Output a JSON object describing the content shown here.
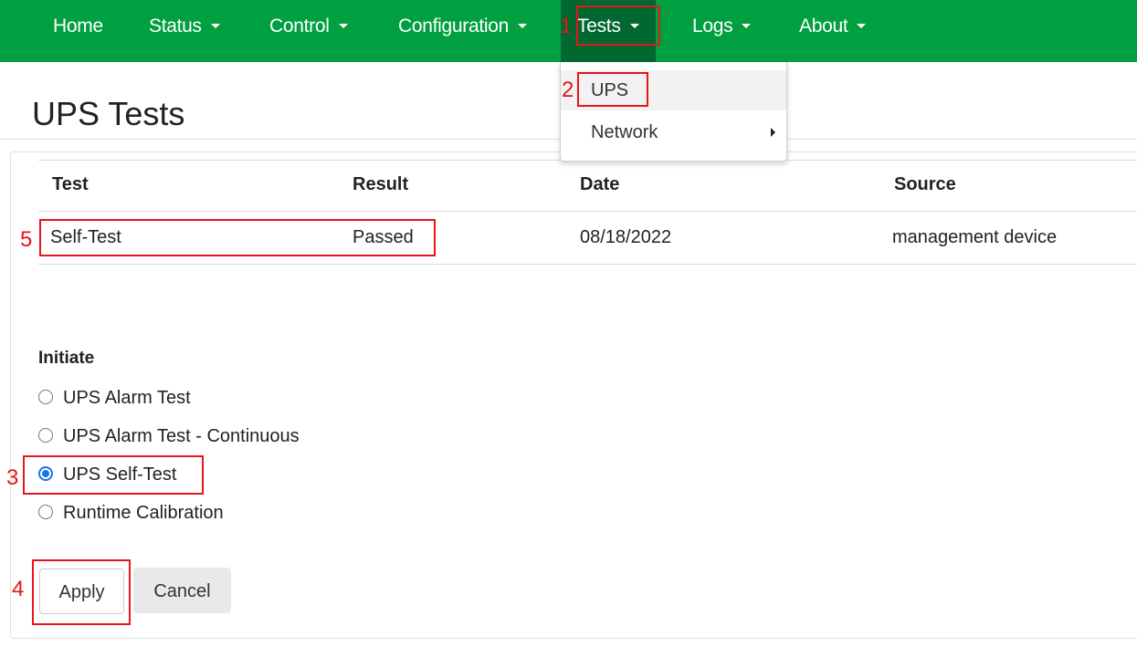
{
  "nav": {
    "home": "Home",
    "status": "Status",
    "control": "Control",
    "configuration": "Configuration",
    "tests": "Tests",
    "logs": "Logs",
    "about": "About"
  },
  "tests_menu": {
    "ups": "UPS",
    "network": "Network"
  },
  "page": {
    "title": "UPS Tests"
  },
  "results_table": {
    "headers": [
      "Test",
      "Result",
      "Date",
      "Source"
    ],
    "rows": [
      [
        "Self-Test",
        "Passed",
        "08/18/2022",
        "management device"
      ]
    ]
  },
  "initiate": {
    "label": "Initiate",
    "options": [
      {
        "label": "UPS Alarm Test",
        "checked": false
      },
      {
        "label": "UPS Alarm Test - Continuous",
        "checked": false
      },
      {
        "label": "UPS Self-Test",
        "checked": true
      },
      {
        "label": "Runtime Calibration",
        "checked": false
      }
    ]
  },
  "buttons": {
    "apply": "Apply",
    "cancel": "Cancel"
  },
  "annotations": [
    "1",
    "2",
    "3",
    "4",
    "5"
  ],
  "colors": {
    "navbar": "#00a040",
    "navbar_active": "#006830",
    "annotation": "#e8141b",
    "radio_checked": "#1a73e8"
  }
}
